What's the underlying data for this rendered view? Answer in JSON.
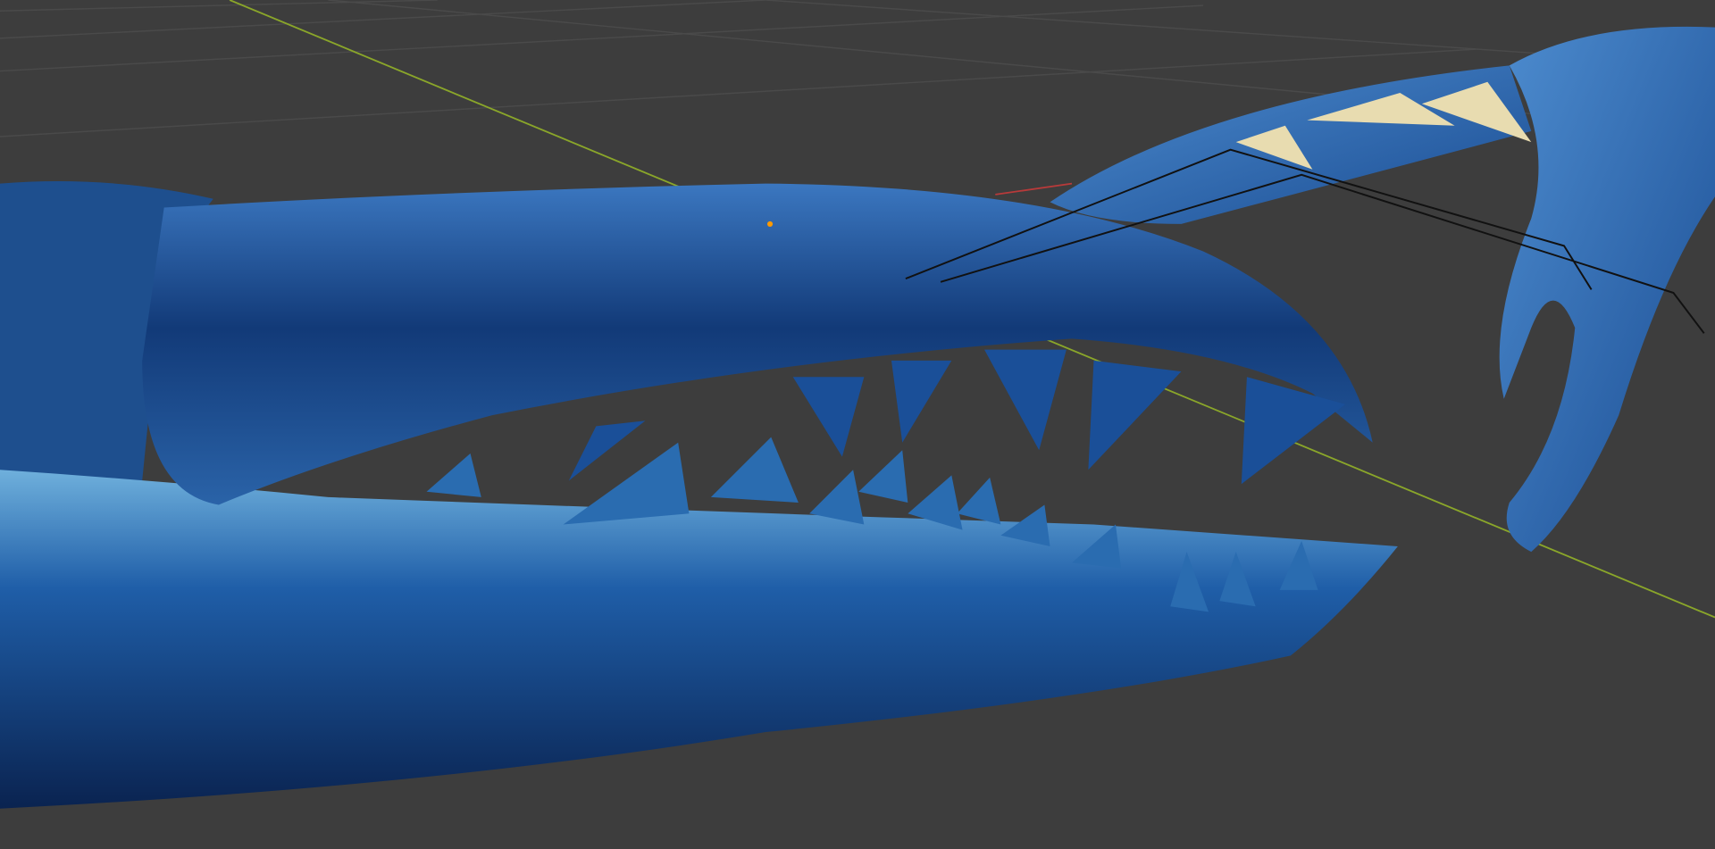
{
  "viewport": {
    "kind": "3d-viewport",
    "colors": {
      "background": "#3d3d3d",
      "grid": "#4a4a4a",
      "axis_y": "#8aa62a",
      "axis_x": "#b83a3a",
      "shell_dark": "#0c2a5a",
      "shell_mid": "#1f5ea8",
      "shell_light": "#6aa6d8",
      "tooth_tip": "#e8dcb0",
      "armature": "#111111"
    },
    "icons": [
      "origin-point-icon"
    ]
  }
}
